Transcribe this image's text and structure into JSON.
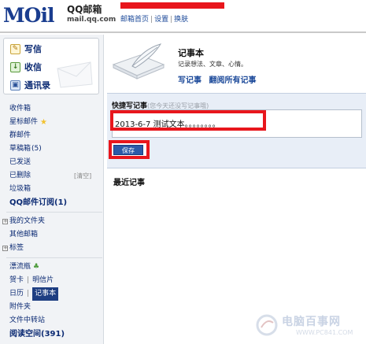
{
  "header": {
    "logo_text": "MOil",
    "logo_title": "QQ邮箱",
    "logo_domain": "mail.qq.com",
    "nav": [
      "邮箱首页",
      "设置",
      "换肤"
    ],
    "nav_separator": "|",
    "redaction_color": "#e8161c"
  },
  "sidebar": {
    "quick_actions": [
      {
        "label": "写信",
        "icon": "pencil-icon"
      },
      {
        "label": "收信",
        "icon": "inbox-icon"
      },
      {
        "label": "通讯录",
        "icon": "contacts-icon"
      }
    ],
    "folders": [
      {
        "label": "收件箱"
      },
      {
        "label": "星标邮件",
        "icon": "star-icon"
      },
      {
        "label": "群邮件"
      },
      {
        "label": "草稿箱",
        "count": "(5)"
      },
      {
        "label": "已发送"
      },
      {
        "label": "已删除",
        "action": "[清空]"
      },
      {
        "label": "垃圾箱"
      },
      {
        "label": "QQ邮件订阅",
        "count": "(1)"
      }
    ],
    "groups": [
      {
        "label": "我的文件夹"
      },
      {
        "label": "其他邮箱"
      },
      {
        "label": "标签"
      }
    ],
    "apps": {
      "drift_bottle": "漂流瓶",
      "card": "贺卡",
      "postcard": "明信片",
      "calendar": "日历",
      "notepad": "记事本",
      "attachments": "附件夹",
      "file_transfer": "文件中转站",
      "reading_space": "阅读空间",
      "reading_space_count": "(391)",
      "divider": "|"
    }
  },
  "main": {
    "title": "记事本",
    "subtitle": "记录想法、文章、心情。",
    "links": {
      "write": "写记事",
      "browse": "翻阅所有记事"
    },
    "compose": {
      "label": "快捷写记事",
      "hint": "(您今天还没写记事哦)",
      "value": "2013-6-7 测试文本。。。。。。。。"
    },
    "save_label": "保存",
    "recent_title": "最近记事"
  },
  "watermark": {
    "text": "电脑百事网",
    "url": "WWW.PC841.COM"
  }
}
